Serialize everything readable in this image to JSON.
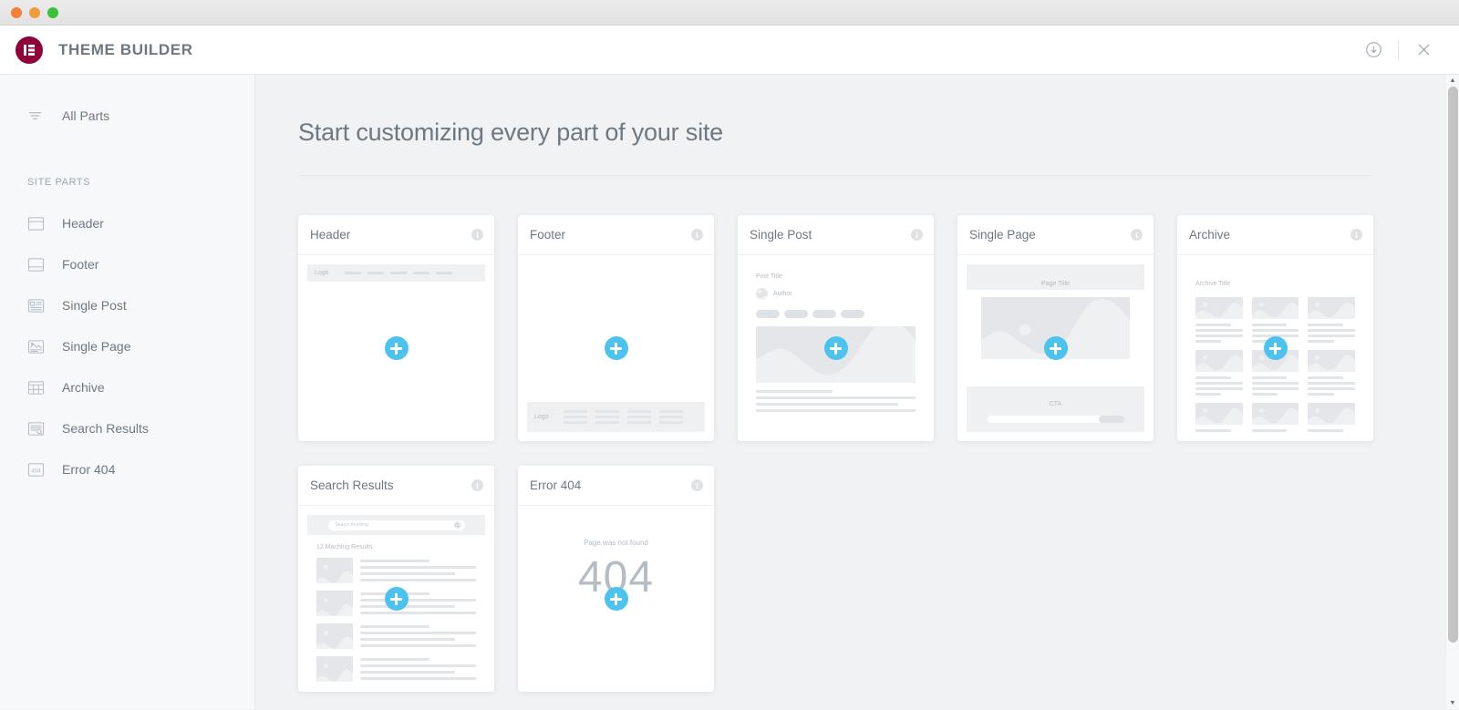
{
  "window": {
    "traffic_lights": [
      "close",
      "minimize",
      "zoom"
    ]
  },
  "header": {
    "title": "THEME BUILDER",
    "logo_icon": "elementor-logo-icon",
    "actions": [
      {
        "name": "import-export-icon",
        "label": ""
      },
      {
        "name": "close-icon",
        "label": ""
      }
    ]
  },
  "sidebar": {
    "all_parts": {
      "label": "All Parts",
      "icon": "filter-lines-icon"
    },
    "section_title": "SITE PARTS",
    "items": [
      {
        "label": "Header",
        "icon": "header-layout-icon"
      },
      {
        "label": "Footer",
        "icon": "footer-layout-icon"
      },
      {
        "label": "Single Post",
        "icon": "single-post-icon"
      },
      {
        "label": "Single Page",
        "icon": "single-page-icon"
      },
      {
        "label": "Archive",
        "icon": "archive-grid-icon"
      },
      {
        "label": "Search Results",
        "icon": "search-results-icon"
      },
      {
        "label": "Error 404",
        "icon": "error-404-icon"
      }
    ]
  },
  "main": {
    "page_title": "Start customizing every part of your site",
    "add_button_icon": "plus-icon",
    "info_icon_glyph": "i",
    "cards": [
      {
        "title": "Header",
        "preview": {
          "type": "header",
          "logo_label": "Logo",
          "nav_items": 5
        }
      },
      {
        "title": "Footer",
        "preview": {
          "type": "footer",
          "logo_label": "Logo",
          "columns": 4,
          "lines_per_column": 3
        }
      },
      {
        "title": "Single Post",
        "preview": {
          "type": "single-post",
          "post_title_label": "Post Title",
          "author_label": "Author",
          "pills": 4,
          "body_lines": 4
        }
      },
      {
        "title": "Single Page",
        "preview": {
          "type": "single-page",
          "page_title_label": "Page Title",
          "cta_label": "CTA"
        }
      },
      {
        "title": "Archive",
        "preview": {
          "type": "archive",
          "archive_title_label": "Archive Title",
          "columns": 3,
          "rows": 3
        }
      },
      {
        "title": "Search Results",
        "preview": {
          "type": "search-results",
          "search_placeholder": "Search Anything",
          "results_count_label": "12 Maching Results",
          "result_rows": 4
        }
      },
      {
        "title": "Error 404",
        "preview": {
          "type": "error-404",
          "message": "Page was not found",
          "code": "404"
        }
      }
    ]
  },
  "scrollbar": {
    "up_arrow": "▲",
    "down_arrow": "▼"
  },
  "colors": {
    "brand": "#92003b",
    "accent": "#4cc3ee",
    "text": "#6d7882",
    "muted": "#b4bcc4",
    "app_bg": "#f1f2f3",
    "sidebar_bg": "#f7f8f9"
  }
}
